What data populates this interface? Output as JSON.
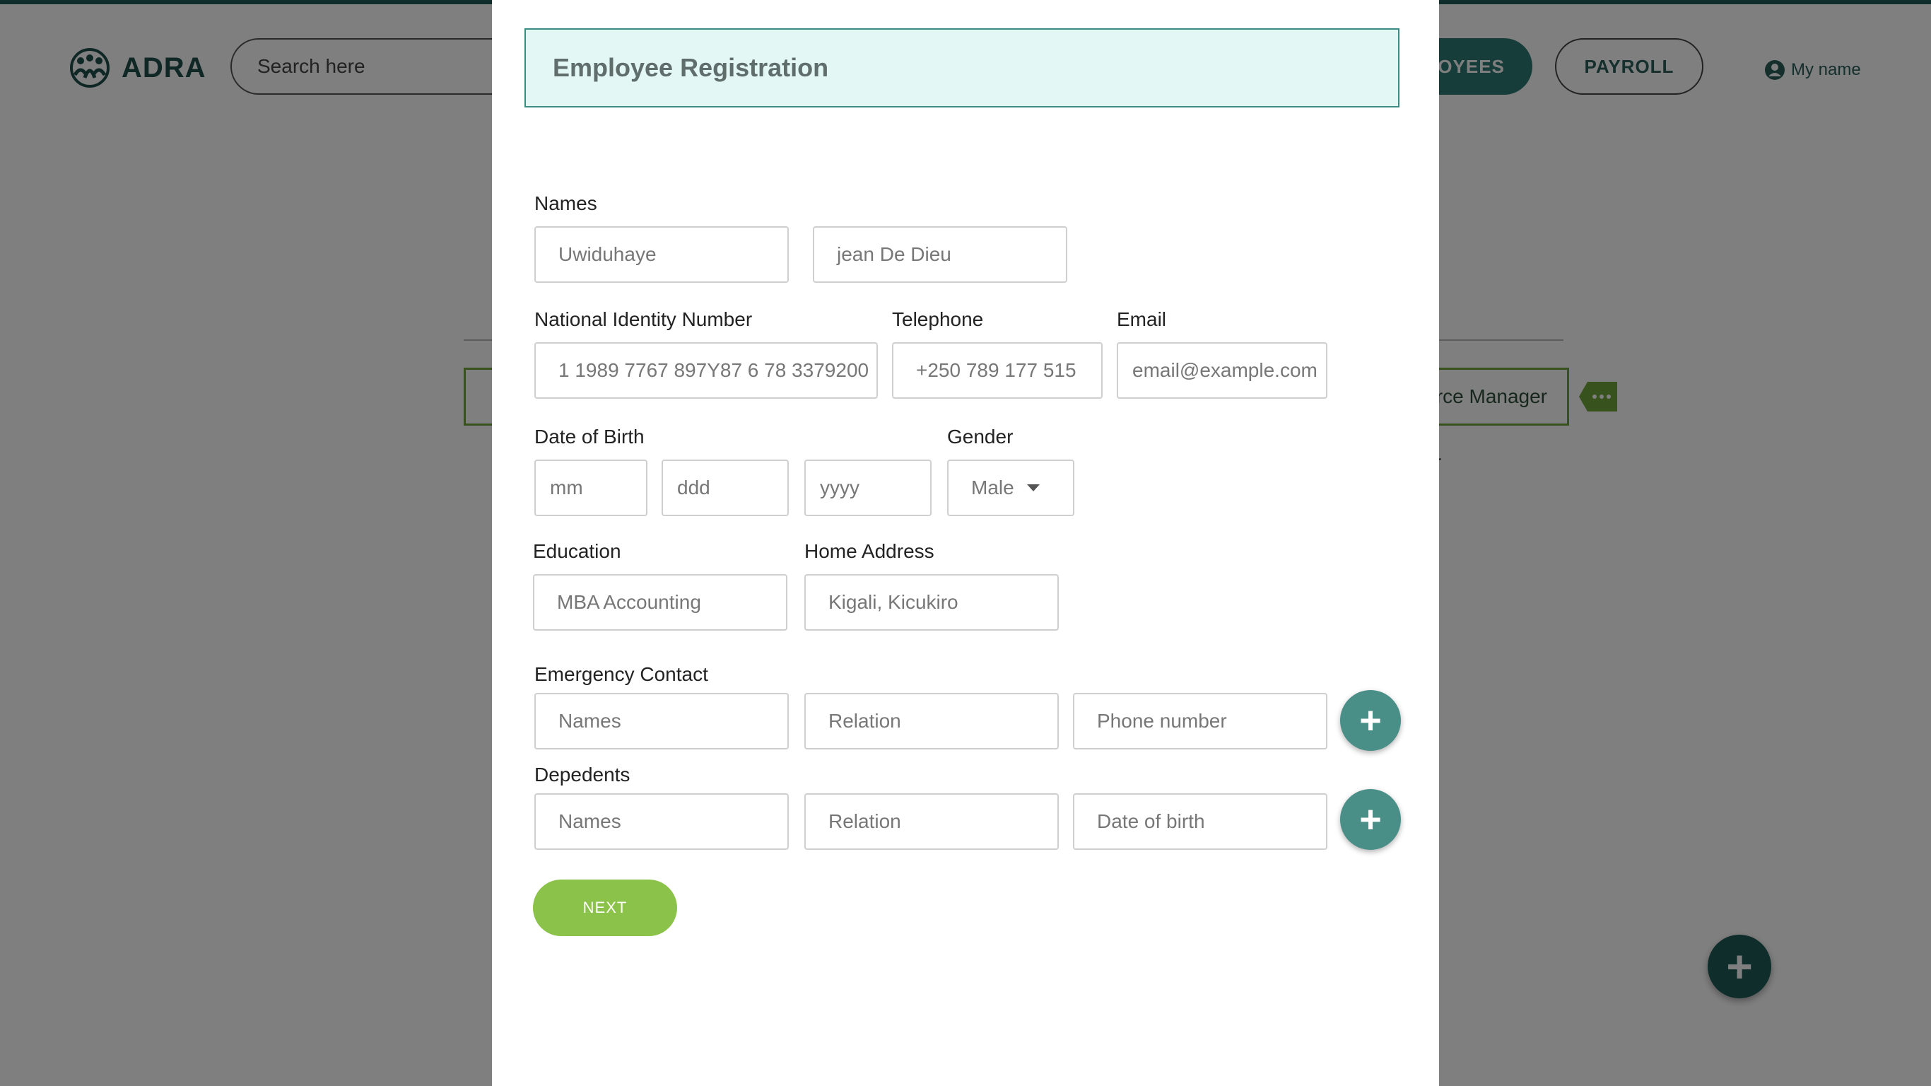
{
  "app": {
    "logo_text": "ADRA",
    "search_placeholder": "Search here",
    "nav": {
      "employees": "PLOYEES",
      "payroll": "PAYROLL"
    },
    "user_name": "My name",
    "background": {
      "role_text": "rce Manager",
      "sub_text": "er"
    },
    "colors": {
      "brand_dark": "#1f5a56",
      "accent_green": "#8bc34a",
      "fab": "#4a8e88"
    }
  },
  "modal": {
    "title": "Employee Registration",
    "names": {
      "label": "Names",
      "first_value": "Uwiduhaye",
      "last_value": "jean De Dieu"
    },
    "nid": {
      "label": "National Identity Number",
      "value": "1 1989 7767 897Y87 6 78 3379200"
    },
    "telephone": {
      "label": "Telephone",
      "value": "+250 789 177 515"
    },
    "email": {
      "label": "Email",
      "placeholder": "email@example.com"
    },
    "dob": {
      "label": "Date of Birth",
      "mm": "mm",
      "dd": "ddd",
      "yyyy": "yyyy"
    },
    "gender": {
      "label": "Gender",
      "value": "Male"
    },
    "education": {
      "label": "Education",
      "value": "MBA Accounting"
    },
    "home_address": {
      "label": "Home Address",
      "value": "Kigali, Kicukiro"
    },
    "emergency": {
      "label": "Emergency Contact",
      "names": "Names",
      "relation": "Relation",
      "phone": "Phone number"
    },
    "dependents": {
      "label": "Depedents",
      "names": "Names",
      "relation": "Relation",
      "dob": "Date of birth"
    },
    "plus": "+",
    "next_label": "NEXT"
  },
  "fab_plus": "+"
}
